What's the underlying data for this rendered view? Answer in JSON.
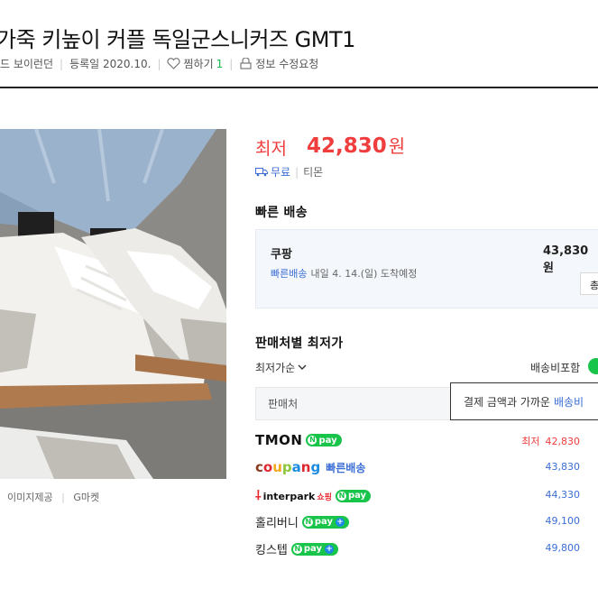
{
  "product": {
    "title": "가죽 키높이 커플 독일군스니커즈 GMT1",
    "brand": "드 보이런던",
    "registered": "등록일 2020.10.",
    "wish_label": "찜하기",
    "wish_count": "1",
    "report_label": "정보 수정요청"
  },
  "image": {
    "source_label": "이미지제공",
    "source_mall": "G마켓"
  },
  "price": {
    "label": "최저",
    "value": "42,830",
    "unit": "원",
    "shipping": "무료",
    "mall": "티몬"
  },
  "fast_delivery": {
    "heading": "빠른 배송",
    "store": "쿠팡",
    "price": "43,830원",
    "badge": "빠른배송",
    "eta": "내일 4. 14.(일) 도착예정",
    "button": "총"
  },
  "sellers": {
    "heading": "판매처별 최저가",
    "sort_label": "최저가순",
    "shipping_toggle_label": "배송비포함",
    "column_label": "판매처",
    "tooltip_text": "결제 금액과 가까운",
    "tooltip_highlight": "배송비",
    "lowest_tag": "최저",
    "rows": [
      {
        "mall": "TMON",
        "price": "42,830",
        "npay": "pay"
      },
      {
        "mall": "coupang",
        "extra": "빠른배송",
        "price": "43,830"
      },
      {
        "mall": "interpark",
        "extra": "쇼핑",
        "price": "44,330",
        "npay": "pay"
      },
      {
        "mall": "홀리버니",
        "price": "49,100",
        "npay": "pay"
      },
      {
        "mall": "킹스텝",
        "price": "49,800",
        "npay": "pay"
      }
    ]
  },
  "colors": {
    "price_red": "#f03e3e",
    "link_blue": "#3b6ed6",
    "npay_green": "#19c44b",
    "coupang_red": "#e0282f",
    "coupang_blue": "#1d8ce0"
  }
}
